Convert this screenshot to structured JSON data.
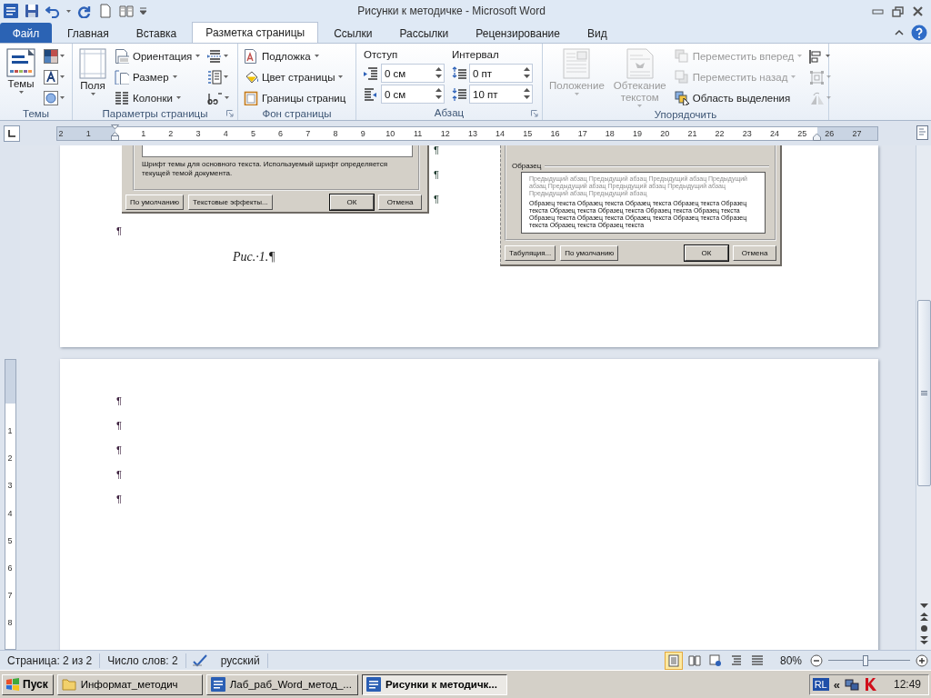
{
  "window": {
    "title": "Рисунки к методичке - Microsoft Word"
  },
  "tabs": [
    {
      "label": "Файл",
      "kind": "file",
      "selected": false
    },
    {
      "label": "Главная",
      "kind": "tab",
      "selected": false
    },
    {
      "label": "Вставка",
      "kind": "tab",
      "selected": false
    },
    {
      "label": "Разметка страницы",
      "kind": "tab",
      "selected": true
    },
    {
      "label": "Ссылки",
      "kind": "tab",
      "selected": false
    },
    {
      "label": "Рассылки",
      "kind": "tab",
      "selected": false
    },
    {
      "label": "Рецензирование",
      "kind": "tab",
      "selected": false
    },
    {
      "label": "Вид",
      "kind": "tab",
      "selected": false
    }
  ],
  "ribbon": [
    {
      "kind": "themes",
      "title": "Темы",
      "buttons": [
        {
          "label": "Темы"
        }
      ]
    },
    {
      "kind": "page_setup",
      "title": "Параметры страницы",
      "buttons": [
        {
          "label": "Поля"
        },
        {
          "label": "Ориентация"
        },
        {
          "label": "Размер"
        },
        {
          "label": "Колонки"
        }
      ]
    },
    {
      "kind": "page_background",
      "title": "Фон страницы",
      "buttons": [
        {
          "label": "Подложка"
        },
        {
          "label": "Цвет страницы"
        },
        {
          "label": "Границы страниц"
        }
      ]
    },
    {
      "kind": "paragraph",
      "title": "Абзац",
      "indent": {
        "label": "Отступ",
        "values": [
          "0 см",
          "0 см"
        ]
      },
      "spacing": {
        "label": "Интервал",
        "values": [
          "0 пт",
          "10 пт"
        ]
      }
    },
    {
      "kind": "arrange",
      "title": "Упорядочить",
      "buttons": [
        {
          "label": "Положение",
          "disabled": true
        },
        {
          "label": "Обтекание текстом",
          "disabled": true
        },
        {
          "label": "Переместить вперед",
          "disabled": true
        },
        {
          "label": "Переместить назад",
          "disabled": true
        },
        {
          "label": "Область выделения",
          "disabled": false
        }
      ],
      "icon_buttons": [
        {
          "disabled": false
        },
        {
          "disabled": true
        },
        {
          "disabled": true
        }
      ]
    }
  ],
  "ruler": {
    "labels": [
      "2",
      "1",
      "1",
      "2",
      "3",
      "4",
      "5",
      "6",
      "7",
      "8",
      "9",
      "10",
      "11",
      "12",
      "13",
      "14",
      "15",
      "16",
      "17",
      "18",
      "19",
      "20",
      "21",
      "22",
      "23",
      "24",
      "25",
      "26",
      "27"
    ]
  },
  "vertical_ruler": {
    "labels": [
      "1",
      "2",
      "3",
      "4",
      "5",
      "6",
      "7",
      "8"
    ]
  },
  "document": {
    "page1": {
      "dialog_left": {
        "description": "Шрифт темы для основного текста. Используемый шрифт определяется текущей темой документа.",
        "buttons": [
          {
            "label": "По умолчанию",
            "default": false
          },
          {
            "label": "Текстовые эффекты...",
            "default": false
          },
          {
            "label": "ОК",
            "default": true
          },
          {
            "label": "Отмена",
            "default": false
          }
        ]
      },
      "side_marks": [
        "¶",
        "¶",
        "¶"
      ],
      "empty_paragraph": "¶",
      "caption": "Рис.·1.¶",
      "dialog_right": {
        "group": "Образец",
        "preview_previous": "Предыдущий абзац Предыдущий абзац Предыдущий абзац Предыдущий абзац Предыдущий абзац Предыдущий абзац Предыдущий абзац Предыдущий абзац Предыдущий абзац",
        "preview_sample": "Образец текста Образец текста Образец текста Образец текста Образец текста Образец текста Образец текста Образец текста Образец текста Образец текста Образец текста Образец текста Образец текста Образец текста Образец текста Образец текста",
        "buttons": [
          {
            "label": "Табуляция...",
            "default": false
          },
          {
            "label": "По умолчанию",
            "default": false
          },
          {
            "label": "ОК",
            "default": true
          },
          {
            "label": "Отмена",
            "default": false
          }
        ]
      }
    },
    "page2": {
      "paragraphs": [
        "¶",
        "¶",
        "¶",
        "¶",
        "¶"
      ]
    }
  },
  "status_bar": {
    "page": "Страница: 2 из 2",
    "words": "Число слов: 2",
    "language": "русский",
    "views": [
      {
        "selected": true
      },
      {
        "selected": false
      },
      {
        "selected": false
      },
      {
        "selected": false
      },
      {
        "selected": false
      }
    ],
    "zoom": "80%",
    "zoom_slider": {
      "level": 0.46
    }
  },
  "taskbar": {
    "start": "Пуск",
    "tasks": [
      {
        "label": "Информат_методич",
        "selected": false
      },
      {
        "label": "Лаб_раб_Word_метод_...",
        "selected": false
      },
      {
        "label": "Рисунки к методичк...",
        "selected": true
      }
    ],
    "tray": {
      "language": "RL",
      "expand": "«",
      "clock": "12:49"
    }
  }
}
